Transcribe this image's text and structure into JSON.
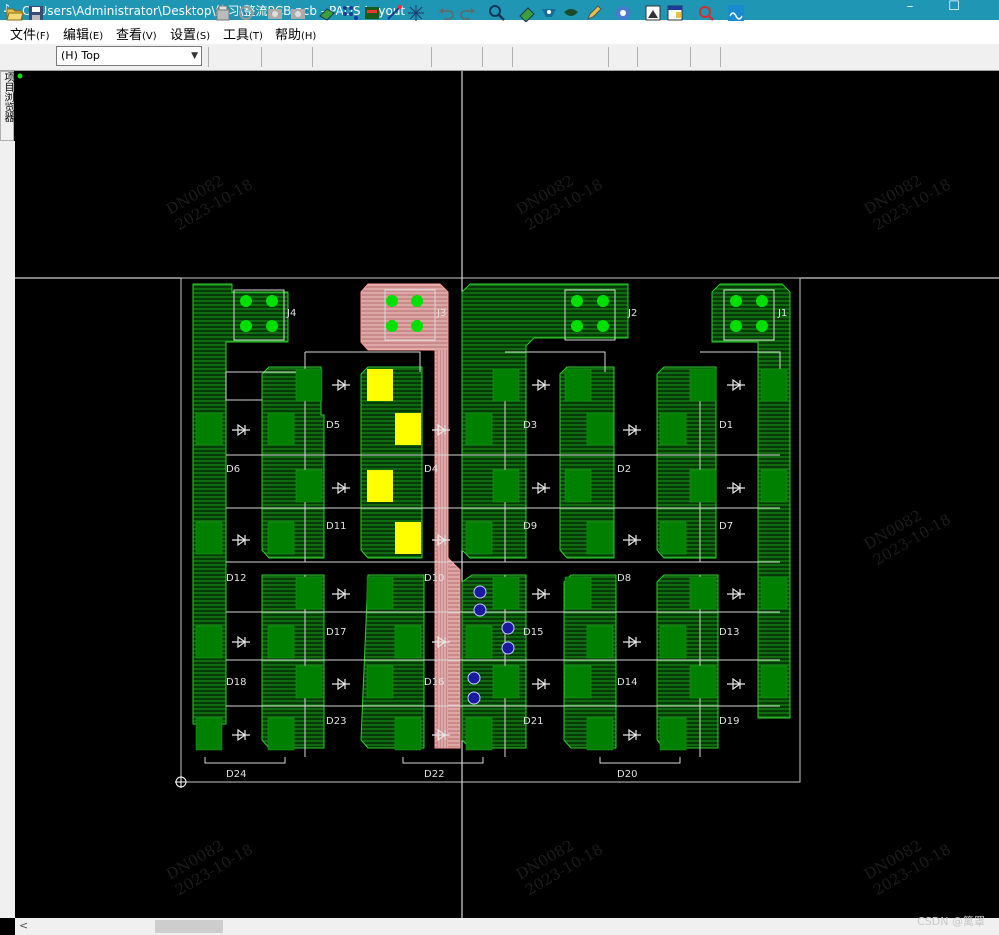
{
  "window": {
    "title": "C:\\Users\\Administrator\\Desktop\\练习\\整流PCB.pcb - PADS Layout",
    "minimize": "–",
    "maximize": "☐"
  },
  "menu": [
    {
      "label": "文件",
      "accel": "(F)"
    },
    {
      "label": "编辑",
      "accel": "(E)"
    },
    {
      "label": "查看",
      "accel": "(V)"
    },
    {
      "label": "设置",
      "accel": "(S)"
    },
    {
      "label": "工具",
      "accel": "(T)"
    },
    {
      "label": "帮助",
      "accel": "(H)"
    }
  ],
  "toolbar": {
    "layer": "(H) Top",
    "icons": [
      "open-icon",
      "save-icon",
      "properties-icon",
      "refresh-icon",
      "camera-icon",
      "camera2-icon",
      "design-icon",
      "route-icon",
      "drafting-icon",
      "sketch-icon",
      "cluster-icon",
      "undo-icon",
      "redo-icon",
      "zoom-icon",
      "dimension-icon",
      "view-icon",
      "layer-icon",
      "pen-icon",
      "stats-icon",
      "report-icon",
      "window-icon",
      "verify-icon",
      "cam-icon"
    ]
  },
  "side_tab": "项目浏览器",
  "board": {
    "connectors": [
      "J4",
      "J3",
      "J2",
      "J1"
    ],
    "diodes": {
      "row1": [
        "D5",
        "D4",
        "D3",
        "D1"
      ],
      "row2": [
        "D6",
        "D2"
      ],
      "row3": [
        "D11",
        "D9",
        "D7"
      ],
      "row4": [
        "D12",
        "D10",
        "D8"
      ],
      "row5": [
        "D17",
        "D15",
        "D13"
      ],
      "row6": [
        "D18",
        "D16",
        "D14"
      ],
      "row7": [
        "D23",
        "D21",
        "D19"
      ],
      "bottom": [
        "D24",
        "D22",
        "D20"
      ]
    },
    "watermark_code": "DN0082",
    "watermark_date": "2023-10-18"
  },
  "colors": {
    "copper": "#0d6e0d",
    "pad": "#008000",
    "highlight": "#ffff00",
    "red_pour": "#e6a5a5",
    "via": "#1a1aa0",
    "outline": "#ffffff",
    "titlebar": "#1e96b4"
  },
  "footer_watermark": "CSDN @篱罩"
}
